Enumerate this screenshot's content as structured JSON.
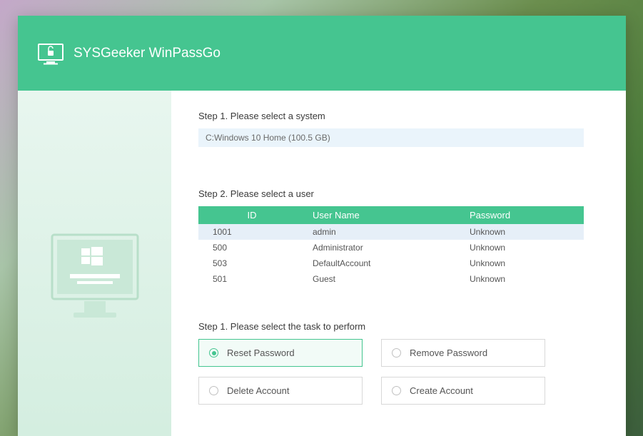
{
  "header": {
    "title": "SYSGeeker WinPassGo"
  },
  "steps": {
    "step1_label": "Step 1. Please select a system",
    "system_selected": "C:Windows 10 Home (100.5 GB)",
    "step2_label": "Step 2. Please select a user",
    "step3_label": "Step 1. Please select the task to perform"
  },
  "user_table": {
    "headers": {
      "id": "ID",
      "username": "User Name",
      "password": "Password"
    },
    "rows": [
      {
        "id": "1001",
        "username": "admin",
        "password": "Unknown",
        "selected": true
      },
      {
        "id": "500",
        "username": "Administrator",
        "password": "Unknown",
        "selected": false
      },
      {
        "id": "503",
        "username": "DefaultAccount",
        "password": "Unknown",
        "selected": false
      },
      {
        "id": "501",
        "username": "Guest",
        "password": "Unknown",
        "selected": false
      }
    ]
  },
  "tasks": [
    {
      "label": "Reset Password",
      "selected": true
    },
    {
      "label": "Remove Password",
      "selected": false
    },
    {
      "label": "Delete Account",
      "selected": false
    },
    {
      "label": "Create Account",
      "selected": false
    }
  ],
  "colors": {
    "accent": "#45c590"
  }
}
